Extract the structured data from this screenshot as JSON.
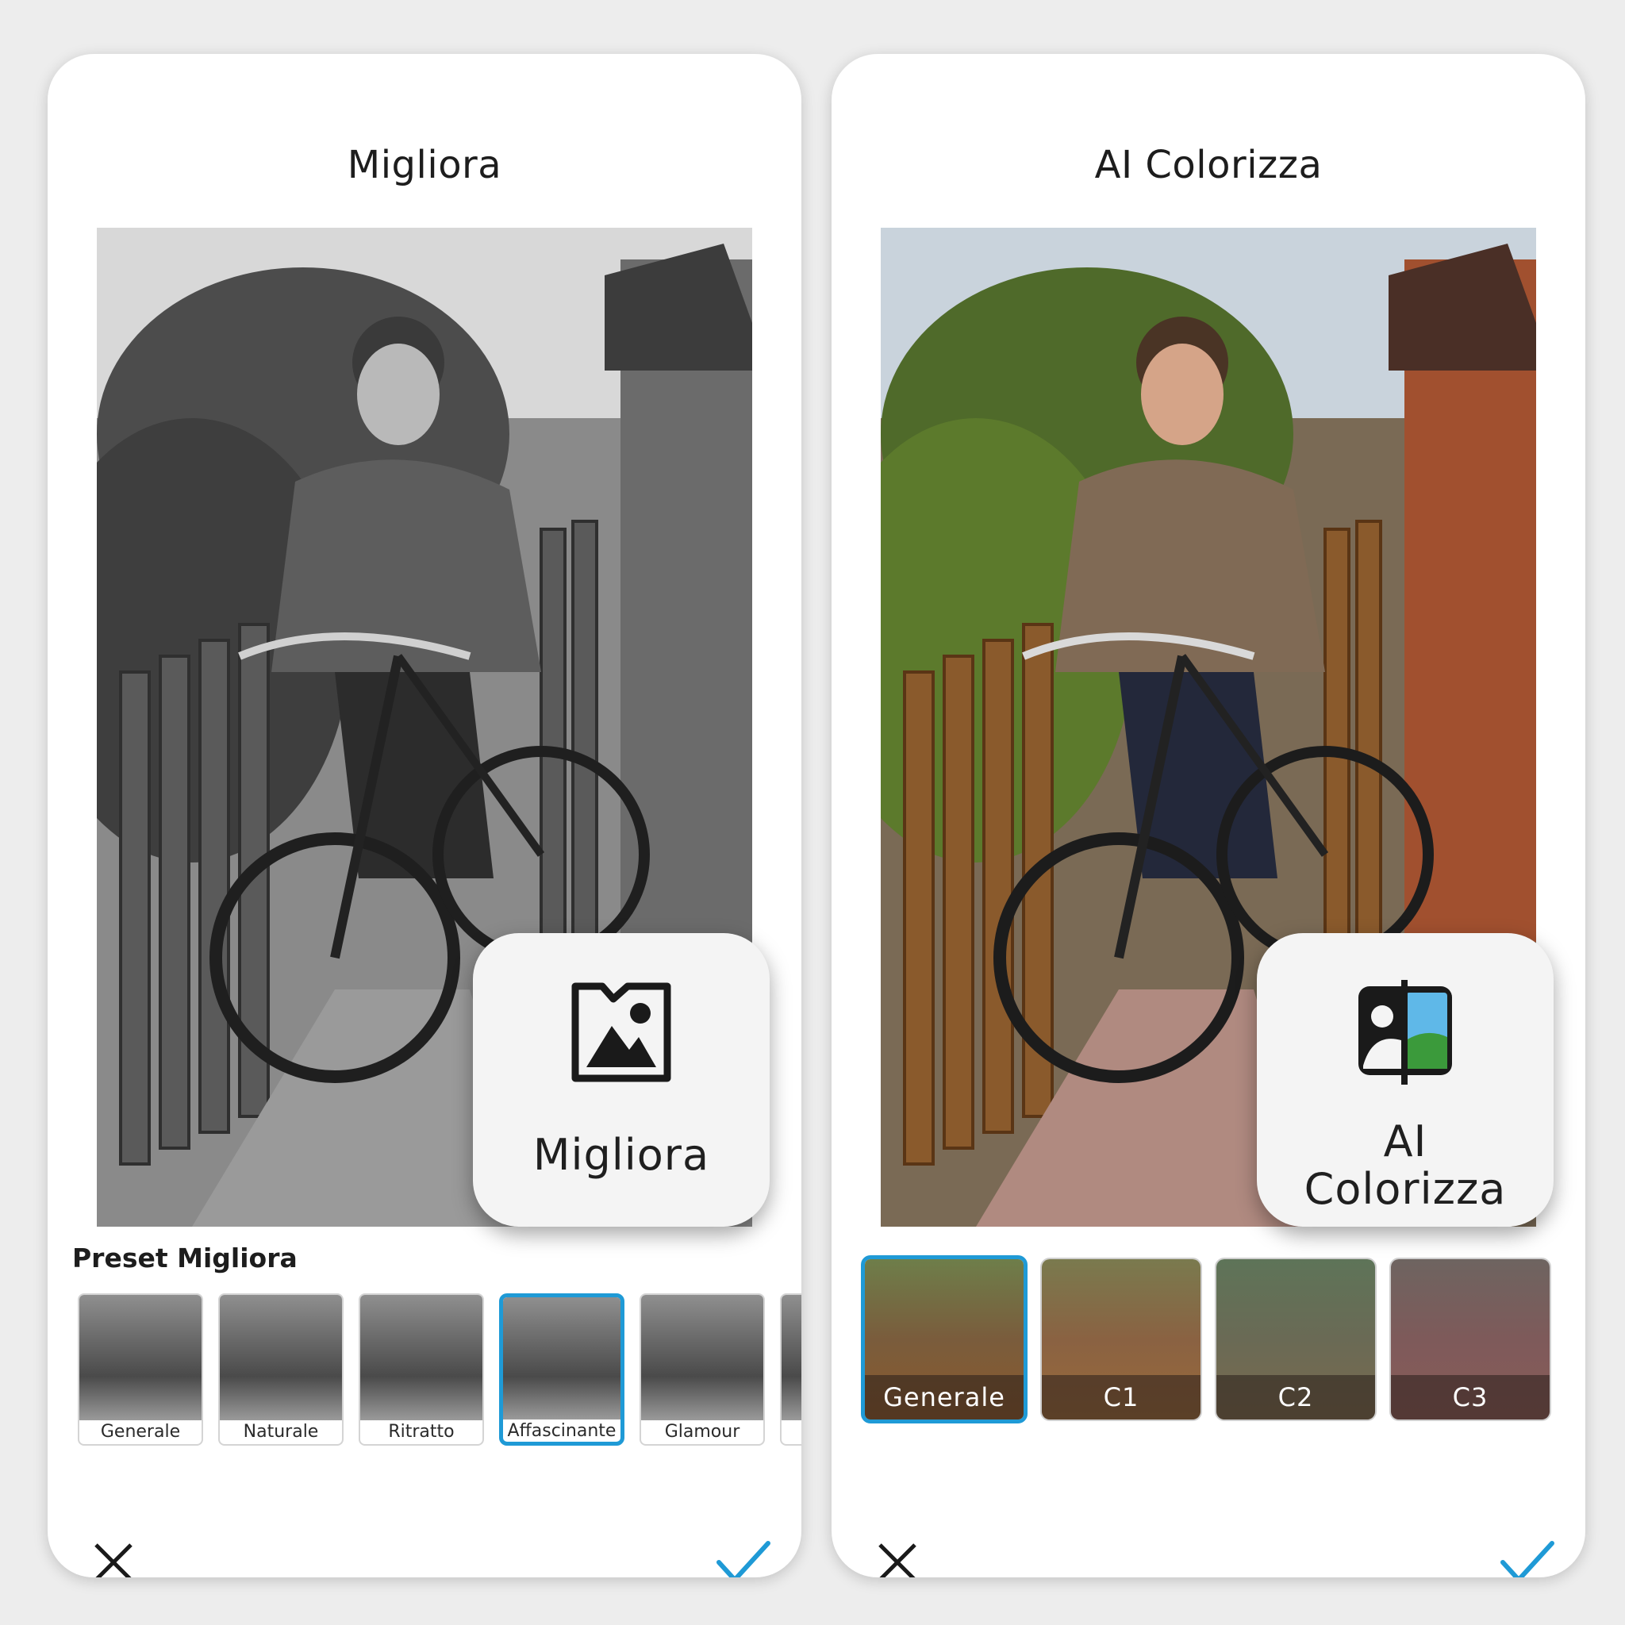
{
  "left": {
    "title": "Migliora",
    "feature_label": "Migliora",
    "feature_icon": "image-enhance-icon",
    "preset_heading": "Preset Migliora",
    "presets": [
      "Generale",
      "Naturale",
      "Ritratto",
      "Affascinante",
      "Glamour"
    ],
    "selected_preset": "Affascinante"
  },
  "right": {
    "title": "AI Colorizza",
    "feature_label": "AI Colorizza",
    "feature_icon": "ai-colorize-icon",
    "presets": [
      "Generale",
      "C1",
      "C2",
      "C3"
    ],
    "selected_preset": "Generale"
  },
  "actions": {
    "close_icon": "close-icon",
    "confirm_icon": "checkmark-icon"
  },
  "colors": {
    "accent": "#1f9ad6",
    "panel_bg": "#ffffff",
    "page_bg": "#ededed"
  }
}
